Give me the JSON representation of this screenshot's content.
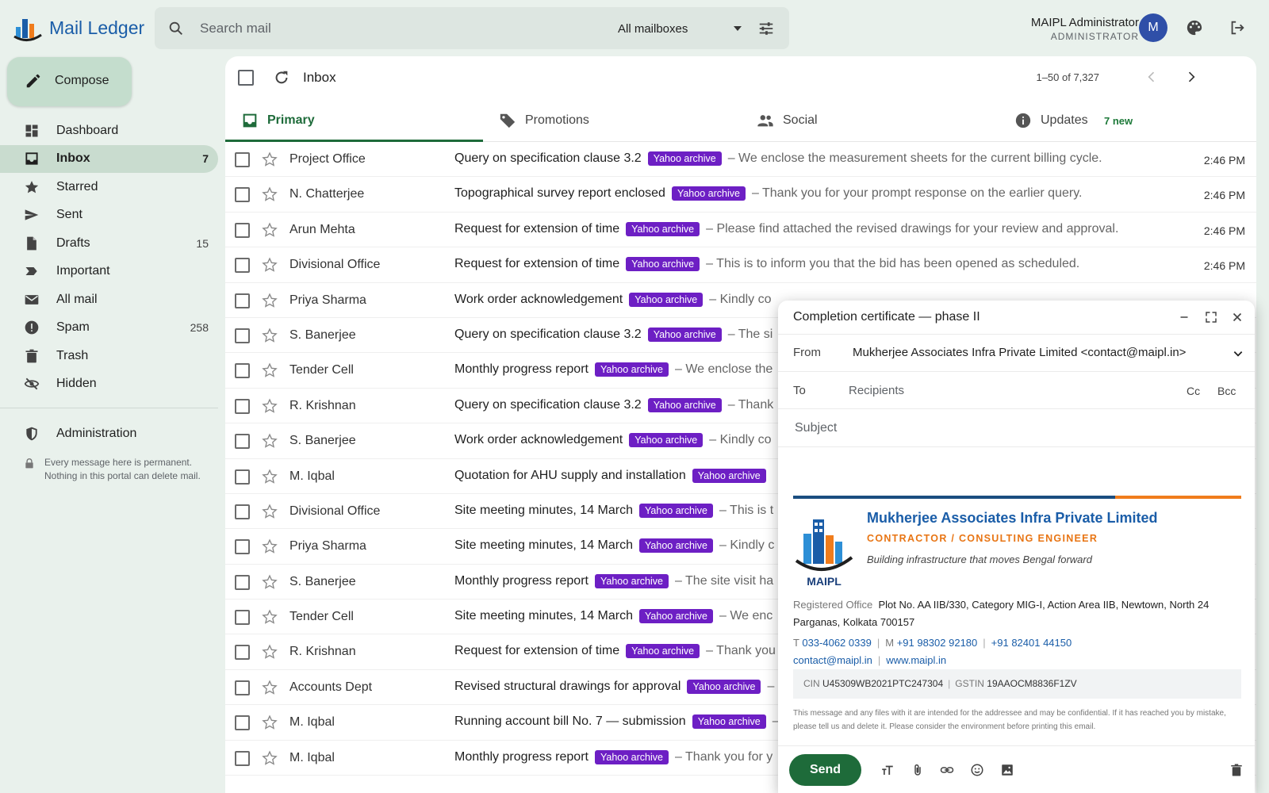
{
  "app": {
    "name": "Mail Ledger"
  },
  "search": {
    "placeholder": "Search mail",
    "mailbox_selected": "All mailboxes"
  },
  "user": {
    "name": "MAIPL Administrator",
    "role": "ADMINISTRATOR",
    "avatar_letter": "M"
  },
  "compose_button": "Compose",
  "sidebar": {
    "items": [
      {
        "label": "Dashboard",
        "icon": "dashboard-icon",
        "count": ""
      },
      {
        "label": "Inbox",
        "icon": "inbox-icon",
        "count": "7",
        "active": true
      },
      {
        "label": "Starred",
        "icon": "star-icon",
        "count": ""
      },
      {
        "label": "Sent",
        "icon": "send-icon",
        "count": ""
      },
      {
        "label": "Drafts",
        "icon": "draft-icon",
        "count": "15"
      },
      {
        "label": "Important",
        "icon": "important-icon",
        "count": ""
      },
      {
        "label": "All mail",
        "icon": "mail-icon",
        "count": ""
      },
      {
        "label": "Spam",
        "icon": "spam-icon",
        "count": "258"
      },
      {
        "label": "Trash",
        "icon": "trash-icon",
        "count": ""
      },
      {
        "label": "Hidden",
        "icon": "hidden-icon",
        "count": ""
      }
    ],
    "admin_label": "Administration",
    "notice": "Every message here is permanent. Nothing in this portal can delete mail."
  },
  "toolbar": {
    "folder": "Inbox",
    "pager": "1–50 of 7,327"
  },
  "tabs": [
    {
      "label": "Primary",
      "icon": "inbox-tab-icon",
      "badge": ""
    },
    {
      "label": "Promotions",
      "icon": "tag-icon",
      "badge": ""
    },
    {
      "label": "Social",
      "icon": "people-icon",
      "badge": ""
    },
    {
      "label": "Updates",
      "icon": "info-icon",
      "badge": "7 new"
    }
  ],
  "label_text": "Yahoo archive",
  "emails": [
    {
      "sender": "Project Office",
      "subject": "Query on specification clause 3.2",
      "snippet": "– We enclose the measurement sheets for the current billing cycle.",
      "time": "2:46 PM"
    },
    {
      "sender": "N. Chatterjee",
      "subject": "Topographical survey report enclosed",
      "snippet": "– Thank you for your prompt response on the earlier query.",
      "time": "2:46 PM"
    },
    {
      "sender": "Arun Mehta",
      "subject": "Request for extension of time",
      "snippet": "– Please find attached the revised drawings for your review and approval.",
      "time": "2:46 PM"
    },
    {
      "sender": "Divisional Office",
      "subject": "Request for extension of time",
      "snippet": "– This is to inform you that the bid has been opened as scheduled.",
      "time": "2:46 PM"
    },
    {
      "sender": "Priya Sharma",
      "subject": "Work order acknowledgement",
      "snippet": "– Kindly co",
      "time": ""
    },
    {
      "sender": "S. Banerjee",
      "subject": "Query on specification clause 3.2",
      "snippet": "– The si",
      "time": ""
    },
    {
      "sender": "Tender Cell",
      "subject": "Monthly progress report",
      "snippet": "– We enclose the",
      "time": ""
    },
    {
      "sender": "R. Krishnan",
      "subject": "Query on specification clause 3.2",
      "snippet": "– Thank",
      "time": ""
    },
    {
      "sender": "S. Banerjee",
      "subject": "Work order acknowledgement",
      "snippet": "– Kindly co",
      "time": ""
    },
    {
      "sender": "M. Iqbal",
      "subject": "Quotation for AHU supply and installation",
      "snippet": "",
      "time": ""
    },
    {
      "sender": "Divisional Office",
      "subject": "Site meeting minutes, 14 March",
      "snippet": "– This is t",
      "time": ""
    },
    {
      "sender": "Priya Sharma",
      "subject": "Site meeting minutes, 14 March",
      "snippet": "– Kindly c",
      "time": ""
    },
    {
      "sender": "S. Banerjee",
      "subject": "Monthly progress report",
      "snippet": "– The site visit ha",
      "time": ""
    },
    {
      "sender": "Tender Cell",
      "subject": "Site meeting minutes, 14 March",
      "snippet": "– We enc",
      "time": ""
    },
    {
      "sender": "R. Krishnan",
      "subject": "Request for extension of time",
      "snippet": "– Thank you",
      "time": ""
    },
    {
      "sender": "Accounts Dept",
      "subject": "Revised structural drawings for approval",
      "snippet": "–",
      "time": ""
    },
    {
      "sender": "M. Iqbal",
      "subject": "Running account bill No. 7 — submission",
      "snippet": "–",
      "time": ""
    },
    {
      "sender": "M. Iqbal",
      "subject": "Monthly progress report",
      "snippet": "– Thank you for y",
      "time": ""
    }
  ],
  "compose": {
    "title": "Completion certificate — phase II",
    "from_label": "From",
    "from_value": "Mukherjee Associates Infra Private Limited <contact@maipl.in>",
    "to_label": "To",
    "to_placeholder": "Recipients",
    "cc": "Cc",
    "bcc": "Bcc",
    "subject_placeholder": "Subject",
    "send": "Send",
    "signature": {
      "logo_text": "MAIPL",
      "company": "Mukherjee Associates Infra Private Limited",
      "role": "CONTRACTOR / CONSULTING ENGINEER",
      "tagline": "Building infrastructure that moves Bengal forward",
      "office_label": "Registered Office",
      "address": "Plot No. AA IIB/330, Category MIG-I, Action Area IIB, Newtown, North 24 Parganas, Kolkata 700157",
      "t_label": "T",
      "phone": "033-4062 0339",
      "m_label": "M",
      "mobile1": "+91 98302 92180",
      "mobile2": "+91 82401 44150",
      "email": "contact@maipl.in",
      "web": "www.maipl.in",
      "cin_label": "CIN",
      "cin": "U45309WB2021PTC247304",
      "gstin_label": "GSTIN",
      "gstin": "19AAOCM8836F1ZV",
      "disclaimer": "This message and any files with it are intended for the addressee and may be confidential. If it has reached you by mistake, please tell us and delete it. Please consider the environment before printing this email."
    }
  },
  "colors": {
    "accent": "#1e6b3a",
    "label": "#6d1fc4",
    "brand": "#1a5da8",
    "orange": "#f07c1c"
  }
}
